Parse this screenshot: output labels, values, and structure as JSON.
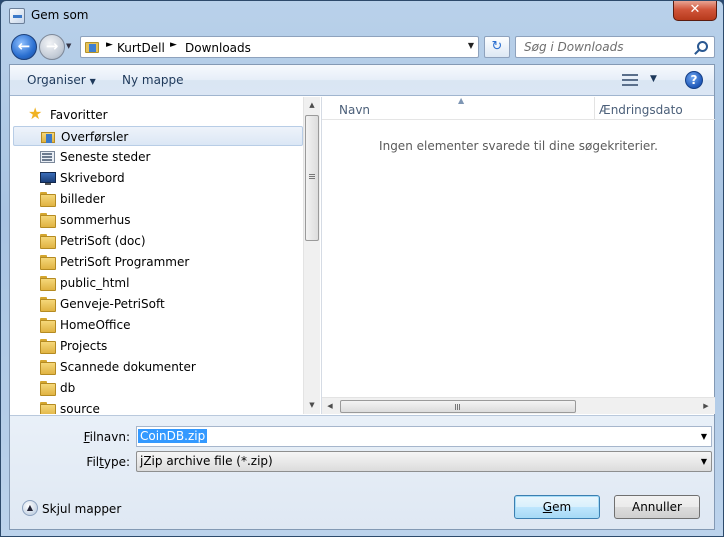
{
  "window": {
    "title": "Gem som",
    "close_label": "✕"
  },
  "address": {
    "crumbs": [
      "KurtDell",
      "Downloads"
    ]
  },
  "search": {
    "placeholder": "Søg i Downloads"
  },
  "toolbar": {
    "organize_label": "Organiser",
    "new_folder_label": "Ny mappe",
    "help_label": "?"
  },
  "nav": {
    "favorites_label": "Favoritter",
    "items": [
      {
        "label": "Overførsler",
        "icon": "downloads-folder-icon",
        "selected": true
      },
      {
        "label": "Seneste steder",
        "icon": "recent-places-icon"
      },
      {
        "label": "Skrivebord",
        "icon": "desktop-icon"
      },
      {
        "label": "billeder",
        "icon": "folder-icon"
      },
      {
        "label": "sommerhus",
        "icon": "folder-icon"
      },
      {
        "label": "PetriSoft (doc)",
        "icon": "folder-icon"
      },
      {
        "label": "PetriSoft Programmer",
        "icon": "folder-icon"
      },
      {
        "label": "public_html",
        "icon": "folder-icon"
      },
      {
        "label": "Genveje-PetriSoft",
        "icon": "folder-icon"
      },
      {
        "label": "HomeOffice",
        "icon": "folder-icon"
      },
      {
        "label": "Projects",
        "icon": "folder-icon"
      },
      {
        "label": "Scannede dokumenter",
        "icon": "folder-icon"
      },
      {
        "label": "db",
        "icon": "folder-icon"
      },
      {
        "label": "source",
        "icon": "folder-icon"
      }
    ]
  },
  "files": {
    "columns": {
      "name": "Navn",
      "date": "Ændringsdato"
    },
    "empty_message": "Ingen elementer svarede til dine søgekriterier."
  },
  "form": {
    "filename_label_accel": "F",
    "filename_label_rest": "ilnavn:",
    "filename_value": "CoinDB.zip",
    "filetype_label_pre": "Fil",
    "filetype_label_accel": "t",
    "filetype_label_rest": "ype:",
    "filetype_value": "jZip archive file (*.zip)",
    "hide_folders_label": "Skjul mapper",
    "save_accel": "G",
    "save_rest": "em",
    "cancel_label": "Annuller"
  },
  "colors": {
    "accent": "#3399ff",
    "frame": "#b9d1ea"
  }
}
